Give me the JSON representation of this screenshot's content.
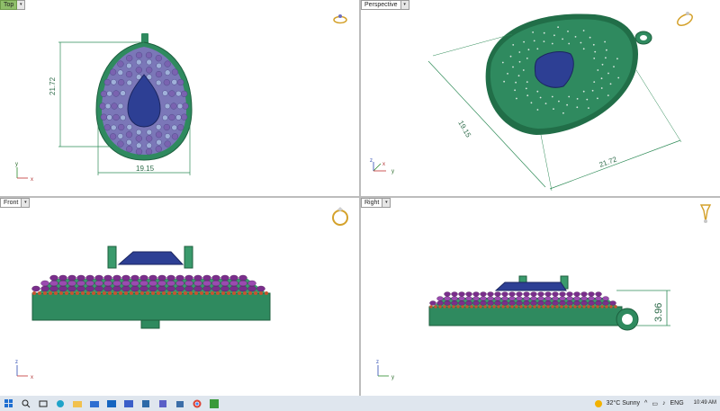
{
  "viewports": {
    "top": {
      "label": "Top",
      "active": true
    },
    "perspective": {
      "label": "Perspective",
      "active": false
    },
    "front": {
      "label": "Front",
      "active": false
    },
    "right": {
      "label": "Right",
      "active": false
    }
  },
  "dimensions": {
    "top_height": "21.72",
    "top_width": "19.15",
    "persp_a": "19.15",
    "persp_b": "21.72",
    "right_thickness": "3.96"
  },
  "axes": {
    "x": "x",
    "y": "y",
    "z": "z"
  },
  "colors": {
    "metal": "#2f8a5f",
    "stone": "#2d3f94",
    "accent_stones": "#8a3a9a",
    "dimension": "#2e8b57",
    "active_tab": "#8fbf6a"
  },
  "taskbar": {
    "icons": [
      "windows-start-icon",
      "search-icon",
      "task-view-icon",
      "edge-icon",
      "file-explorer-icon",
      "mail-icon",
      "outlook-icon",
      "photos-icon",
      "app-icon",
      "teams-icon",
      "store-icon",
      "chrome-icon",
      "rhino-icon"
    ],
    "weather": "32°C  Sunny",
    "language": "ENG",
    "time": "10:49 AM"
  }
}
